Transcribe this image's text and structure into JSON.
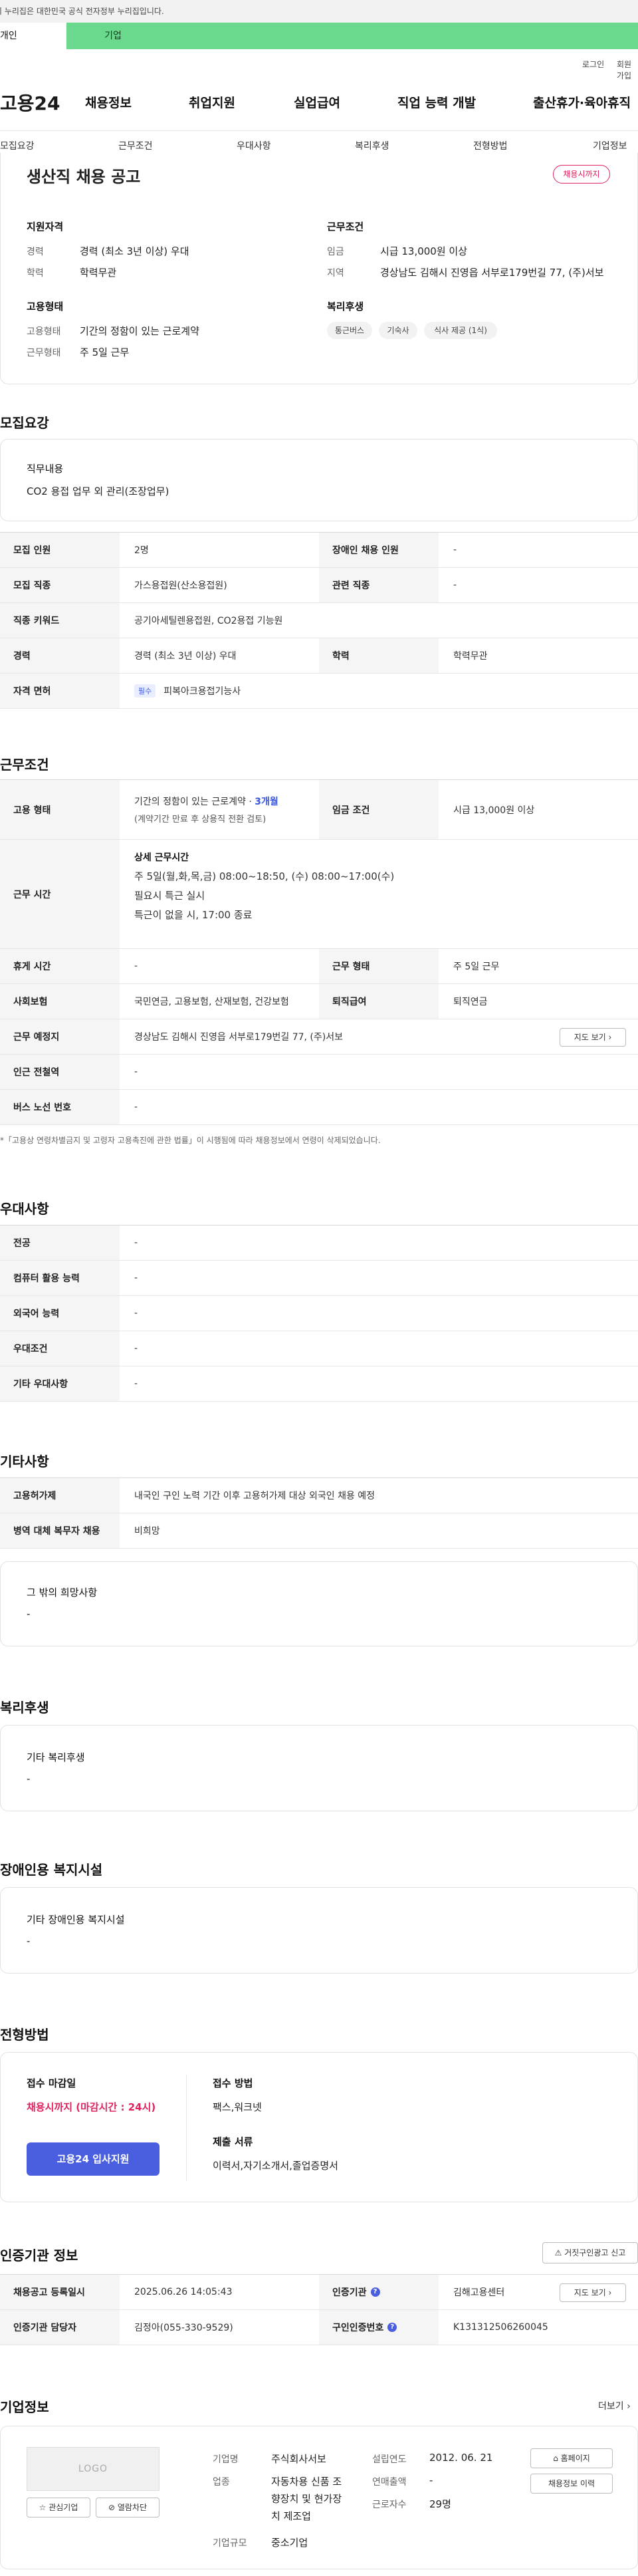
{
  "gov_notice": "이 누리집은 대한민국 공식 전자정부 누리집입니다.",
  "user_tabs": [
    "개인",
    "기업"
  ],
  "util_links": [
    "로그인",
    "회원가입"
  ],
  "logo": "고용24",
  "gnb": [
    "채용정보",
    "취업지원",
    "실업급여",
    "직업 능력 개발",
    "출산휴가·육아휴직"
  ],
  "lnb": [
    "모집요강",
    "근무조건",
    "우대사항",
    "복리후생",
    "전형방법",
    "기업정보"
  ],
  "job": {
    "title": "생산직 채용 공고",
    "status_badge": "채용시까지",
    "qual_title": "지원자격",
    "career_label": "경력",
    "career_value": "경력 (최소 3년 이상) 우대",
    "edu_label": "학력",
    "edu_value": "학력무관",
    "cond_title": "근무조건",
    "wage_label": "임금",
    "wage_value": "시급 13,000원 이상",
    "region_label": "지역",
    "region_value": "경상남도 김해시 진영읍 서부로179번길 77, (주)서보",
    "emp_title": "고용형태",
    "emp_label": "고용형태",
    "emp_value": "기간의 정함이 있는 근로계약",
    "work_label": "근무형태",
    "work_value": "주 5일 근무",
    "welfare_title": "복리후생",
    "welfare_chips": [
      "통근버스",
      "기숙사",
      "식사 제공 (1식)"
    ]
  },
  "recruit": {
    "section_title": "모집요강",
    "duty_title": "직무내용",
    "duty_value": "CO2 용접 업무 외 관리(조장업무)",
    "rows": [
      {
        "l1": "모집 인원",
        "v1": "2명",
        "l2": "장애인 채용 인원",
        "v2": "-"
      },
      {
        "l1": "모집 직종",
        "v1": "가스용접원(산소용접원)",
        "l2": "관련 직종",
        "v2": "-"
      },
      {
        "l1": "직종 키워드",
        "v1": "공기아세틸렌용접원, CO2용접 기능원"
      },
      {
        "l1": "경력",
        "v1": "경력 (최소 3년 이상) 우대",
        "l2": "학력",
        "v2": "학력무관"
      },
      {
        "l1": "자격 면허",
        "tag": "필수",
        "v1": "피복아크용접기능사"
      }
    ]
  },
  "conditions": {
    "section_title": "근무조건",
    "emp_type_label": "고용 형태",
    "emp_type_value": "기간의 정함이 있는 근로계약 ·",
    "emp_type_months": "3개월",
    "emp_type_sub": "(계약기간 만료 후 상용직 전환 검토)",
    "wage_label": "임금 조건",
    "wage_value": "시급 13,000원 이상",
    "hours_label": "근무 시간",
    "hours_title": "상세 근무시간",
    "hours_lines": [
      "주 5일(월,화,목,금) 08:00~18:50, (수) 08:00~17:00(수)",
      "필요시 특근 실시",
      "특근이 없을 시, 17:00 종료"
    ],
    "rest_label": "휴게 시간",
    "rest_value": "-",
    "shift_label": "근무 형태",
    "shift_value": "주 5일 근무",
    "insurance_label": "사회보험",
    "insurance_value": "국민연금, 고용보험, 산재보험, 건강보험",
    "retire_label": "퇴직급여",
    "retire_value": "퇴직연금",
    "place_label": "근무 예정지",
    "place_value": "경상남도 김해시 진영읍 서부로179번길 77, (주)서보",
    "map_button": "지도 보기",
    "subway_label": "인근 전철역",
    "subway_value": "-",
    "bus_label": "버스 노선 번호",
    "bus_value": "-",
    "note": "*「고용상 연령차별금지 및 고령자 고용촉진에 관한 법률」이 시행됨에 따라 채용정보에서 연령이 삭제되었습니다."
  },
  "preferences": {
    "section_title": "우대사항",
    "rows": [
      {
        "label": "전공",
        "value": "-"
      },
      {
        "label": "컴퓨터 활용 능력",
        "value": "-"
      },
      {
        "label": "외국어 능력",
        "value": "-"
      },
      {
        "label": "우대조건",
        "value": "-"
      },
      {
        "label": "기타 우대사항",
        "value": "-"
      }
    ]
  },
  "etc": {
    "section_title": "기타사항",
    "rows": [
      {
        "label": "고용허가제",
        "value": "내국인 구인 노력 기간 이후 고용허가제 대상 외국인 채용 예정"
      },
      {
        "label": "병역 대체 복무자 채용",
        "value": "비희망"
      }
    ],
    "extra_title": "그 밖의 희망사항",
    "extra_value": "-"
  },
  "welfare": {
    "section_title": "복리후생",
    "box_title": "기타 복리후생",
    "box_value": "-"
  },
  "disability": {
    "section_title": "장애인용 복지시설",
    "box_title": "기타 장애인용 복지시설",
    "box_value": "-"
  },
  "selection": {
    "section_title": "전형방법",
    "deadline_title": "접수 마감일",
    "deadline_value": "채용시까지 (마감시간 : 24시)",
    "apply_button": "고용24 입사지원",
    "method_title": "접수 방법",
    "method_value": "팩스,워크넷",
    "docs_title": "제출 서류",
    "docs_value": "이력서,자기소개서,졸업증명서"
  },
  "auth": {
    "section_title": "인증기관 정보",
    "report_button": "거짓구인광고 신고",
    "rows": [
      {
        "l1": "채용공고 등록일시",
        "v1": "2025.06.26 14:05:43",
        "l2": "인증기관",
        "v2": "김해고용센터",
        "btn": "지도 보기"
      },
      {
        "l1": "인증기관 담당자",
        "v1": "김정아(055-330-9529)",
        "l2": "구인인증번호",
        "v2": "K131312506260045"
      }
    ]
  },
  "company": {
    "section_title": "기업정보",
    "more": "더보기",
    "logo_text": "LOGO",
    "fav_button": "관심기업",
    "block_button": "열람차단",
    "name_label": "기업명",
    "name_value": "주식회사서보",
    "industry_label": "업종",
    "industry_value": [
      "자동차용 신품 조",
      "향장치 및 현가장",
      "치 제조업"
    ],
    "size_label": "기업규모",
    "size_value": "중소기업",
    "founded_label": "설립연도",
    "founded_value": "2012. 06. 21",
    "sales_label": "연매출액",
    "sales_value": "-",
    "staff_label": "근로자수",
    "staff_value": "29명",
    "homepage_button": "홈페이지",
    "history_button": "채용정보 이력"
  }
}
